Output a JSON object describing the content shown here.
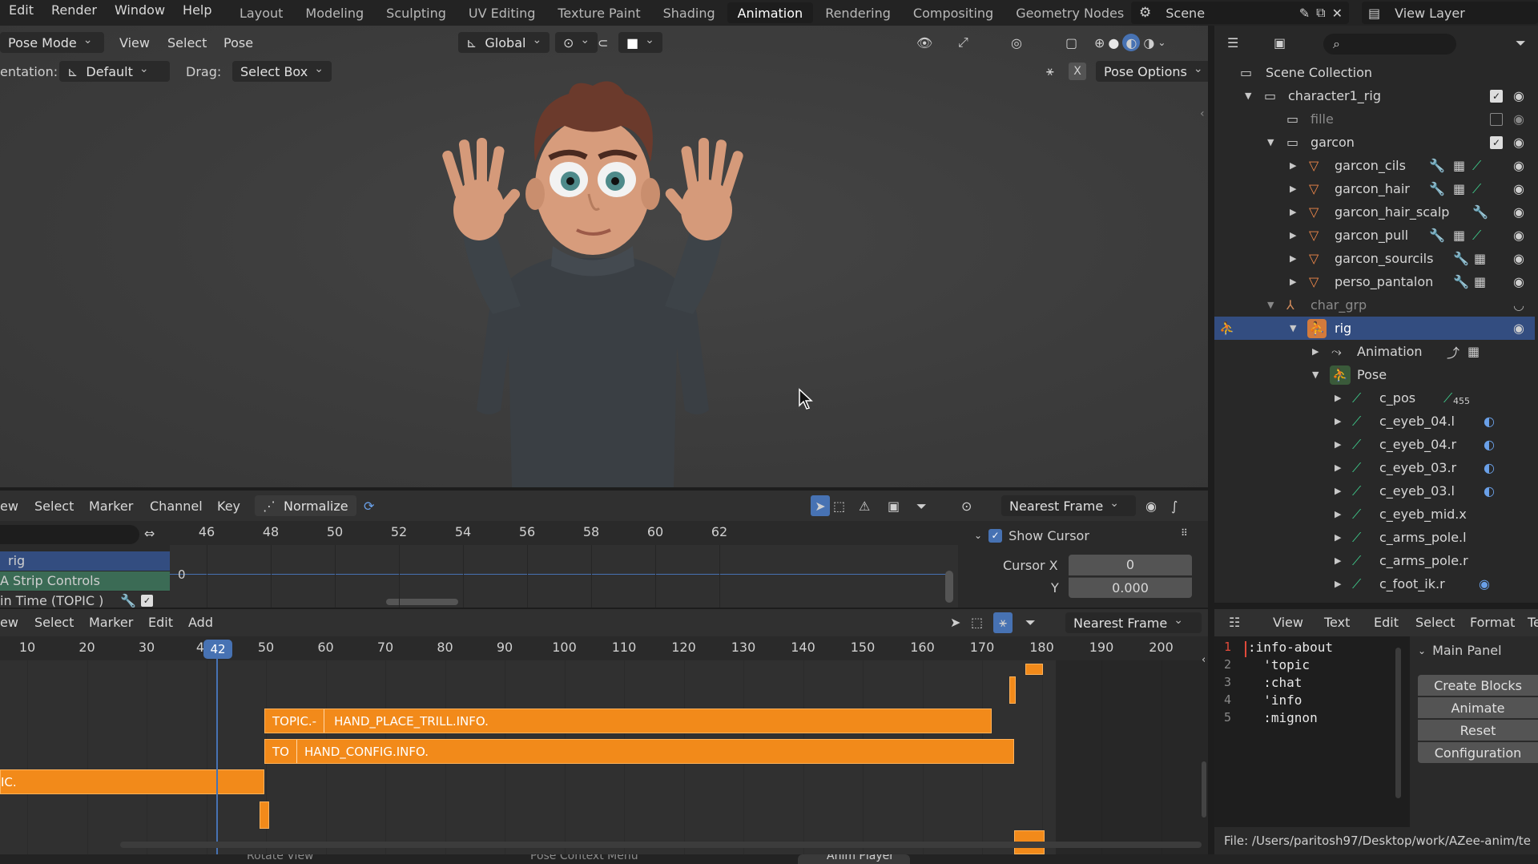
{
  "topbar": {
    "menus": [
      "Edit",
      "Render",
      "Window",
      "Help"
    ],
    "workspaces": [
      "Layout",
      "Modeling",
      "Sculpting",
      "UV Editing",
      "Texture Paint",
      "Shading",
      "Animation",
      "Rendering",
      "Compositing",
      "Geometry Nodes"
    ],
    "active_workspace": "Animation",
    "scene_label": "Scene",
    "view_layer_label": "View Layer"
  },
  "viewport": {
    "mode": "Pose Mode",
    "menus": [
      "View",
      "Select",
      "Pose"
    ],
    "transform_orientation": "Global",
    "orientation_label": "entation:",
    "orientation_value": "Default",
    "drag_label": "Drag:",
    "drag_value": "Select Box",
    "pose_options": "Pose Options"
  },
  "outliner": {
    "root": "Scene Collection",
    "items": [
      {
        "label": "character1_rig",
        "checked": true
      },
      {
        "label": "fille",
        "checked": false
      },
      {
        "label": "garcon",
        "checked": true
      },
      {
        "label": "garcon_cils"
      },
      {
        "label": "garcon_hair"
      },
      {
        "label": "garcon_hair_scalp"
      },
      {
        "label": "garcon_pull"
      },
      {
        "label": "garcon_sourcils"
      },
      {
        "label": "perso_pantalon"
      },
      {
        "label": "char_grp"
      },
      {
        "label": "rig"
      },
      {
        "label": "Animation"
      },
      {
        "label": "Pose"
      },
      {
        "label": "c_pos",
        "badge": "455"
      },
      {
        "label": "c_eyeb_04.l"
      },
      {
        "label": "c_eyeb_04.r"
      },
      {
        "label": "c_eyeb_03.r"
      },
      {
        "label": "c_eyeb_03.l"
      },
      {
        "label": "c_eyeb_mid.x"
      },
      {
        "label": "c_arms_pole.l"
      },
      {
        "label": "c_arms_pole.r"
      },
      {
        "label": "c_foot_ik.r"
      }
    ]
  },
  "graph_editor": {
    "menus": [
      "ew",
      "Select",
      "Marker",
      "Channel",
      "Key"
    ],
    "normalize": "Normalize",
    "snap": "Nearest Frame",
    "ticks": [
      "46",
      "48",
      "50",
      "52",
      "54",
      "56",
      "58",
      "60",
      "62"
    ],
    "channels": [
      "rig",
      "A Strip Controls",
      "in Time (TOPIC )"
    ],
    "zero": "0",
    "show_cursor": "Show Cursor",
    "cursor_x_label": "Cursor X",
    "cursor_x_value": "0",
    "cursor_y_label": "Y",
    "cursor_y_value": "0.000"
  },
  "nla": {
    "menus": [
      "ew",
      "Select",
      "Marker",
      "Edit",
      "Add"
    ],
    "snap": "Nearest Frame",
    "ticks": [
      "10",
      "20",
      "30",
      "4",
      "50",
      "60",
      "70",
      "80",
      "90",
      "100",
      "110",
      "120",
      "130",
      "140",
      "150",
      "160",
      "170",
      "180",
      "190",
      "200"
    ],
    "current_frame": "42",
    "strips": {
      "s1_prefix": "TOPIC.-",
      "s1_name": "HAND_PLACE_TRILL.INFO.",
      "s2_prefix": "TO",
      "s2_name": "HAND_CONFIG.INFO.",
      "s3_name": "IC."
    }
  },
  "text_editor": {
    "menus": [
      "View",
      "Text",
      "Edit",
      "Select",
      "Format",
      "Te"
    ],
    "lines": [
      ":info-about",
      "  'topic",
      "  :chat",
      "  'info",
      "  :mignon"
    ],
    "panel_title": "Main Panel",
    "buttons": [
      "Create Blocks",
      "Animate",
      "Reset",
      "Configuration"
    ],
    "file_path": "File: /Users/paritosh97/Desktop/work/AZee-anim/te"
  },
  "statusbar": {
    "items": [
      "Rotate View",
      "Pose Context Menu",
      "Anim Player"
    ]
  },
  "colors": {
    "accent": "#4772b3",
    "strip": "#f28a1a",
    "bone": "#3fcf8e",
    "mesh": "#f0884a"
  }
}
